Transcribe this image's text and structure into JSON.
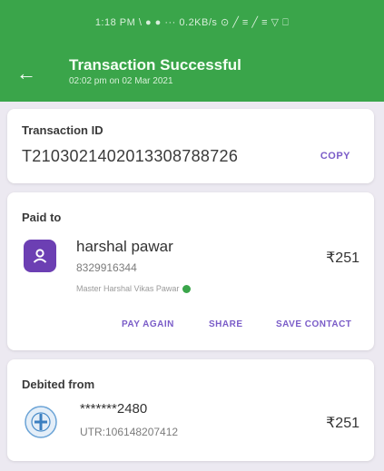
{
  "status_bar": {
    "text": "1:18 PM  \\  ● ●  ···  0.2KB/s ⊙ ╱ ≡ ╱ ≡ ▽ ⎕"
  },
  "header": {
    "title": "Transaction Successful",
    "subtitle": "02:02 pm on 02 Mar 2021"
  },
  "transaction": {
    "label": "Transaction ID",
    "id": "T2103021402013308788726",
    "copy_label": "COPY"
  },
  "paid_to": {
    "label": "Paid to",
    "name": "harshal pawar",
    "phone": "8329916344",
    "full_name": "Master Harshal Vikas Pawar",
    "amount": "₹251",
    "actions": [
      "PAY AGAIN",
      "SHARE",
      "SAVE CONTACT"
    ]
  },
  "debited_from": {
    "label": "Debited from",
    "account": "*******2480",
    "utr": "UTR:106148207412",
    "amount": "₹251"
  },
  "colors": {
    "header_green": "#3aa54a",
    "accent_purple": "#7a5cc8",
    "avatar_purple": "#6c3fb3"
  }
}
